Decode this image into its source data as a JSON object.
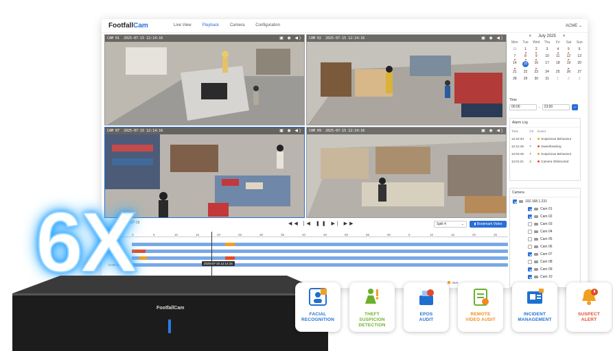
{
  "app": {
    "brand_a": "Footfall",
    "brand_b": "Cam",
    "nav": [
      "Live View",
      "Playback",
      "Camera",
      "Configuration"
    ],
    "active_nav": "Playback",
    "account": "ACME ⌄"
  },
  "cams": [
    {
      "label": "CAM 01",
      "time": "2025-07-15 12:14:16"
    },
    {
      "label": "CAM 02",
      "time": "2025-07-15 12:14:16"
    },
    {
      "label": "CAM 07",
      "time": "2025-07-15 12:14:16"
    },
    {
      "label": "CAM 09",
      "time": "2025-07-15 12:14:16"
    }
  ],
  "calendar": {
    "month": "July 2025",
    "prev": "<",
    "next": ">",
    "days_of_week": [
      "Mon",
      "Tue",
      "Wed",
      "Thu",
      "Fri",
      "Sat",
      "Sun"
    ],
    "days": [
      "30",
      "1",
      "2",
      "3",
      "4",
      "5",
      "6",
      "7",
      "8",
      "9",
      "10",
      "11",
      "12",
      "13",
      "14",
      "15",
      "16",
      "17",
      "18",
      "19",
      "20",
      "21",
      "22",
      "23",
      "24",
      "25",
      "26",
      "27",
      "28",
      "29",
      "30",
      "31",
      "1",
      "2",
      "3"
    ],
    "selected": "15"
  },
  "time": {
    "label": "Time",
    "start": "00:00",
    "end": "23:00",
    "sep": "-",
    "go": "→"
  },
  "alarm": {
    "title": "Alarm Log",
    "headers": [
      "Time",
      "Ch",
      "Event"
    ],
    "rows": [
      {
        "time": "12:22:33",
        "ch": "1",
        "event": "Suspicious Behaviour",
        "color": "#f0a020"
      },
      {
        "time": "12:21:45",
        "ch": "7",
        "event": "Sweethearting",
        "color": "#e14a2a"
      },
      {
        "time": "12:02:45",
        "ch": "7",
        "event": "Suspicious Behaviour",
        "color": "#f0a020"
      },
      {
        "time": "12:01:21",
        "ch": "2",
        "event": "Camera Obstructed",
        "color": "#e14a2a"
      }
    ]
  },
  "camera_panel": {
    "title": "Camera",
    "group": "192.168.1.231",
    "cams": [
      {
        "name": "Cam 01",
        "checked": true
      },
      {
        "name": "Cam 02",
        "checked": true
      },
      {
        "name": "Cam 03",
        "checked": false
      },
      {
        "name": "Cam 04",
        "checked": false
      },
      {
        "name": "Cam 05",
        "checked": false
      },
      {
        "name": "Cam 06",
        "checked": false
      },
      {
        "name": "Cam 07",
        "checked": true
      },
      {
        "name": "Cam 08",
        "checked": false
      },
      {
        "name": "Cam 09",
        "checked": true
      },
      {
        "name": "Cam 10",
        "checked": true
      }
    ]
  },
  "controls": {
    "date": "2025-07-15",
    "split": "Split 4",
    "split_arrow": "⌄",
    "bookmark": "Bookmark Video",
    "playback": "◀◀ |◀ ❚❚ ▶| ▶▶"
  },
  "timeline": {
    "ticks": [
      "0",
      "5",
      "10",
      "15",
      "20",
      "25",
      "30",
      "35",
      "40",
      "45",
      "50",
      "55",
      "60",
      "5",
      "10",
      "15",
      "20",
      "25"
    ],
    "tip": "2025-07-15 12:14:16",
    "cam_label": "CAM 09",
    "legend": "Alert"
  },
  "hero": {
    "text": "6X"
  },
  "device": {
    "brand": "FootfallCam"
  },
  "features": [
    {
      "label": [
        "FACIAL",
        "RECOGNITION"
      ],
      "color": "#1f6fd1",
      "icon": "facial-recognition-icon"
    },
    {
      "label": [
        "THEFT",
        "SUSPICION",
        "DETECTION"
      ],
      "color": "#6ab02a",
      "icon": "theft-detection-icon"
    },
    {
      "label": [
        "EPOS",
        "AUDIT"
      ],
      "color": "#1f6fd1",
      "icon": "epos-audit-icon"
    },
    {
      "label": [
        "REMOTE",
        "VIDEO AUDIT"
      ],
      "color": "#f08a20",
      "icon": "remote-video-audit-icon"
    },
    {
      "label": [
        "INCIDENT",
        "MANAGEMENT"
      ],
      "color": "#1f6fd1",
      "icon": "incident-management-icon"
    },
    {
      "label": [
        "SUSPECT",
        "ALERT"
      ],
      "color": "#e14a2a",
      "icon": "suspect-alert-icon"
    }
  ]
}
